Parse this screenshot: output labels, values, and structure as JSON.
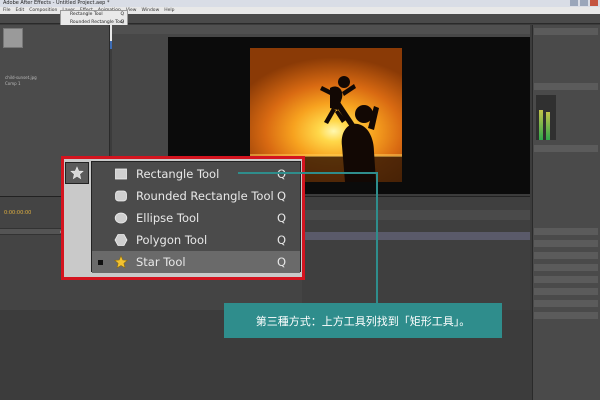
{
  "window": {
    "title": "Adobe After Effects - Untitled Project.aep *"
  },
  "menubar": {
    "items": [
      "File",
      "Edit",
      "Composition",
      "Layer",
      "Effect",
      "Animation",
      "View",
      "Window",
      "Help"
    ]
  },
  "top_tools_menu": {
    "items": [
      {
        "label": "Rectangle Tool",
        "key": "Q"
      },
      {
        "label": "Rounded Rectangle Tool",
        "key": "Q"
      },
      {
        "label": "Ellipse Tool",
        "key": "Q"
      },
      {
        "label": "Polygon Tool",
        "key": "Q"
      },
      {
        "label": "Star Tool",
        "key": "Q",
        "selected": true
      }
    ]
  },
  "project_panel": {
    "items": [
      "child-sunset.jpg",
      "Comp 1"
    ]
  },
  "shape_tool_popup": {
    "items": [
      {
        "label": "Rectangle Tool",
        "key": "Q",
        "icon": "rectangle-icon",
        "selected": false
      },
      {
        "label": "Rounded Rectangle Tool",
        "key": "Q",
        "icon": "rounded-rectangle-icon",
        "selected": false
      },
      {
        "label": "Ellipse Tool",
        "key": "Q",
        "icon": "ellipse-icon",
        "selected": false
      },
      {
        "label": "Polygon Tool",
        "key": "Q",
        "icon": "polygon-icon",
        "selected": false
      },
      {
        "label": "Star Tool",
        "key": "Q",
        "icon": "star-icon",
        "selected": true
      }
    ]
  },
  "timeline": {
    "timecode": "0:00:00:00",
    "layer_name": "child-sunset.jpg"
  },
  "annotation": {
    "text": "第三種方式：上方工具列找到「矩形工具」。"
  },
  "colors": {
    "highlight_border": "#d4141f",
    "callout_bg": "#2f8d8c",
    "menu_bg": "#4b4b4b",
    "selected_row": "#6a6a6a"
  }
}
